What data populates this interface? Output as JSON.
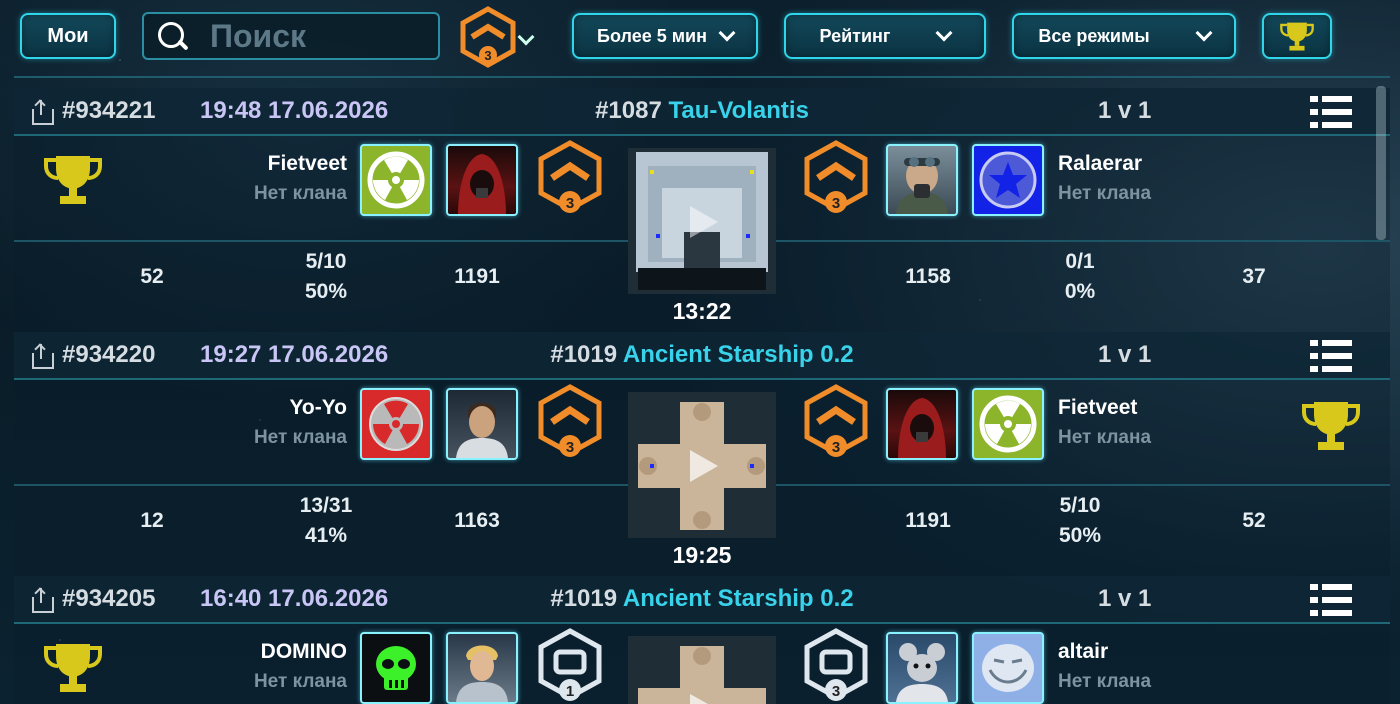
{
  "top_bar": {
    "my_button_label": "Мои",
    "search_placeholder": "Поиск",
    "rank_filter_level": "3",
    "duration_filter": "Более 5 мин",
    "type_filter": "Рейтинг",
    "mode_filter": "Все режимы"
  },
  "colors": {
    "accent": "#2fd5e8",
    "map_name": "#38d2ea",
    "trophy": "#d8c81b",
    "rank_orange": "#f08c2a",
    "rank_silver": "#dfe7ee"
  },
  "matches": [
    {
      "id": "#934221",
      "datetime": "19:48 17.06.2026",
      "map_number": "#1087",
      "map_name": "Tau-Volantis",
      "mode": "1 v 1",
      "duration": "13:22",
      "winner": "left",
      "left": {
        "name": "Fietveet",
        "clan": "Нет клана",
        "emblem": "radiation-icon",
        "avatar": "hooded-figure",
        "rank_level": "3",
        "rank_color": "orange",
        "level": "52",
        "games": "5/10",
        "winrate": "50%",
        "rating": "1191"
      },
      "right": {
        "name": "Ralaerar",
        "clan": "Нет клана",
        "emblem": "star-icon",
        "avatar": "pilot-with-goggles",
        "rank_level": "3",
        "rank_color": "orange",
        "level": "37",
        "games": "0/1",
        "winrate": "0%",
        "rating": "1158"
      }
    },
    {
      "id": "#934220",
      "datetime": "19:27 17.06.2026",
      "map_number": "#1019",
      "map_name": "Ancient Starship 0.2",
      "mode": "1 v 1",
      "duration": "19:25",
      "winner": "right",
      "left": {
        "name": "Yo-Yo",
        "clan": "Нет клана",
        "emblem": "radiation-icon",
        "avatar": "man-portrait",
        "rank_level": "3",
        "rank_color": "orange",
        "level": "12",
        "games": "13/31",
        "winrate": "41%",
        "rating": "1163"
      },
      "right": {
        "name": "Fietveet",
        "clan": "Нет клана",
        "emblem": "radiation-icon",
        "avatar": "hooded-figure",
        "rank_level": "3",
        "rank_color": "orange",
        "level": "52",
        "games": "5/10",
        "winrate": "50%",
        "rating": "1191"
      }
    },
    {
      "id": "#934205",
      "datetime": "16:40 17.06.2026",
      "map_number": "#1019",
      "map_name": "Ancient Starship 0.2",
      "mode": "1 v 1",
      "winner": "left",
      "left": {
        "name": "DOMINO",
        "clan": "Нет клана",
        "emblem": "skull-icon",
        "avatar": "blond-astronaut",
        "rank_level": "1",
        "rank_color": "silver"
      },
      "right": {
        "name": "altair",
        "clan": "Нет клана",
        "emblem": "trollface-icon",
        "avatar": "rat-in-armor",
        "rank_level": "3",
        "rank_color": "silver"
      }
    }
  ]
}
